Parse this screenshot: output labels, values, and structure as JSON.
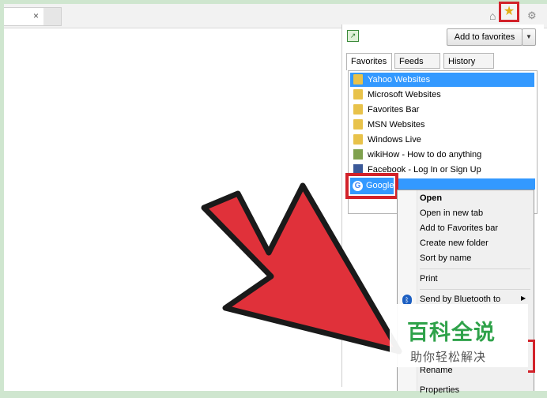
{
  "browser": {
    "tab_close": "×",
    "home_glyph": "⌂",
    "star_glyph": "★",
    "gear_glyph": "⚙"
  },
  "pane": {
    "pin_glyph": "↗",
    "add_to_favorites": "Add to favorites",
    "dropdown_glyph": "▼",
    "tabs": [
      "Favorites",
      "Feeds",
      "History"
    ],
    "items": [
      {
        "label": "Yahoo Websites",
        "icon": "folder-icon"
      },
      {
        "label": "Microsoft Websites",
        "icon": "folder-icon"
      },
      {
        "label": "Favorites Bar",
        "icon": "folder-icon"
      },
      {
        "label": "MSN Websites",
        "icon": "folder-icon"
      },
      {
        "label": "Windows Live",
        "icon": "folder-icon"
      },
      {
        "label": "wikiHow - How to do anything",
        "icon": "wikihow-icon"
      },
      {
        "label": "Facebook - Log In or Sign Up",
        "icon": "facebook-icon"
      }
    ],
    "selected_item": "Google",
    "google_glyph": "G"
  },
  "context_menu": {
    "items": [
      "Open",
      "Open in new tab",
      "Add to Favorites bar",
      "Create new folder",
      "Sort by name",
      "Print",
      "Send by Bluetooth to",
      "Rename",
      "Properties"
    ],
    "bluetooth_glyph": "ᛒ",
    "submenu_arrow": "▶"
  },
  "watermark": {
    "title": "百科全说",
    "subtitle": "助你轻松解决"
  },
  "colors": {
    "highlight_red": "#d2222a",
    "selection_blue": "#3399ff",
    "arrow_red": "#e0313a",
    "watermark_green": "#2fa24a"
  }
}
